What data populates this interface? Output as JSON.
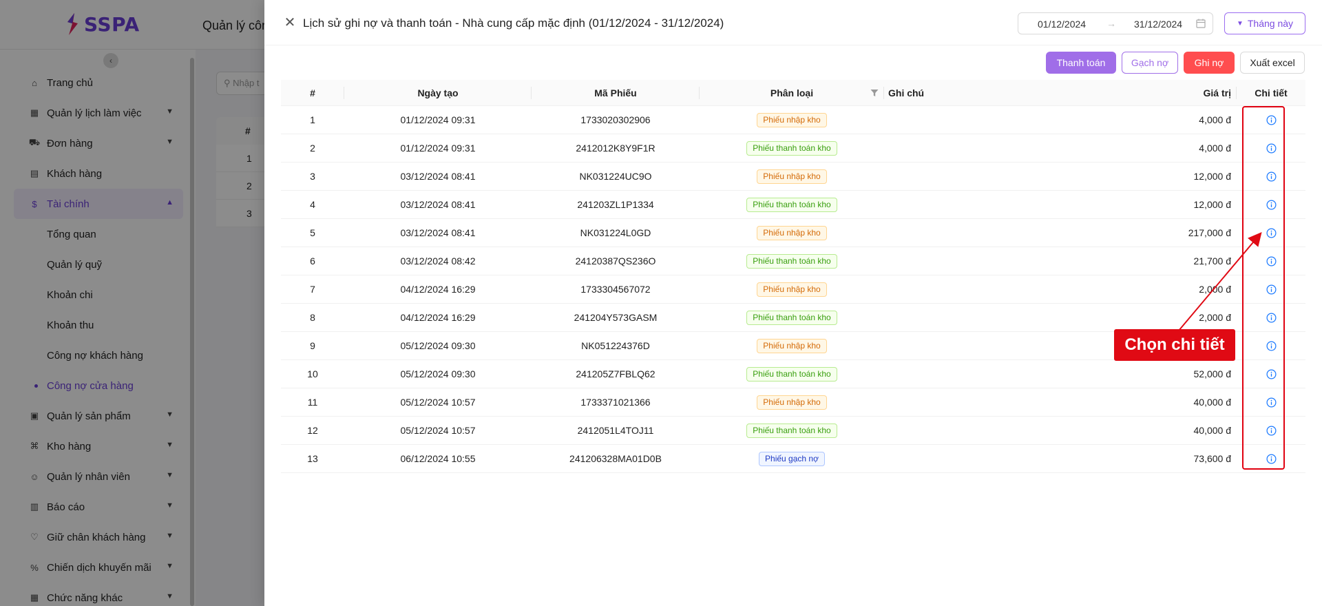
{
  "app": {
    "logo_text": "SSPA",
    "page_title": "Quản lý côn",
    "brand_color": "#6b3fd8"
  },
  "sidebar": {
    "items": [
      {
        "label": "Trang chủ",
        "icon": "home-icon"
      },
      {
        "label": "Quản lý lịch làm việc",
        "icon": "calendar-icon"
      },
      {
        "label": "Đơn hàng",
        "icon": "cart-icon"
      },
      {
        "label": "Khách hàng",
        "icon": "id-card-icon"
      },
      {
        "label": "Tài chính",
        "icon": "dollar-icon"
      },
      {
        "label": "Quản lý sản phẩm",
        "icon": "box-icon"
      },
      {
        "label": "Kho hàng",
        "icon": "warehouse-icon"
      },
      {
        "label": "Quản lý nhân viên",
        "icon": "users-icon"
      },
      {
        "label": "Báo cáo",
        "icon": "chart-icon"
      },
      {
        "label": "Giữ chân khách hàng",
        "icon": "heart-icon"
      },
      {
        "label": "Chiến dịch khuyến mãi",
        "icon": "percent-icon"
      },
      {
        "label": "Chức năng khác",
        "icon": "grid-icon"
      }
    ],
    "finance_sub": [
      "Tổng quan",
      "Quản lý quỹ",
      "Khoản chi",
      "Khoản thu",
      "Công nợ khách hàng",
      "Công nợ cửa hàng"
    ]
  },
  "background": {
    "search_placeholder": "Nhập t",
    "table_header": "#",
    "rows": [
      "1",
      "2",
      "3"
    ]
  },
  "drawer": {
    "title": "Lịch sử ghi nợ và thanh toán - Nhà cung cấp mặc định (01/12/2024 - 31/12/2024)",
    "date_start": "01/12/2024",
    "date_arrow": "→",
    "date_end": "31/12/2024",
    "month_button": "Tháng này",
    "buttons": {
      "pay": "Thanh toán",
      "clear": "Gạch nợ",
      "debt": "Ghi nợ",
      "excel": "Xuất excel"
    },
    "columns": {
      "index": "#",
      "date": "Ngày tạo",
      "code": "Mã Phiếu",
      "type": "Phân loại",
      "note": "Ghi chú",
      "value": "Giá trị",
      "detail": "Chi tiết"
    },
    "rows": [
      {
        "idx": "1",
        "date": "01/12/2024 09:31",
        "code": "1733020302906",
        "type": "Phiếu nhập kho",
        "kind": "import",
        "note": "",
        "value": "4,000 đ"
      },
      {
        "idx": "2",
        "date": "01/12/2024 09:31",
        "code": "2412012K8Y9F1R",
        "type": "Phiếu thanh toán kho",
        "kind": "pay",
        "note": "",
        "value": "4,000 đ"
      },
      {
        "idx": "3",
        "date": "03/12/2024 08:41",
        "code": "NK031224UC9O",
        "type": "Phiếu nhập kho",
        "kind": "import",
        "note": "",
        "value": "12,000 đ"
      },
      {
        "idx": "4",
        "date": "03/12/2024 08:41",
        "code": "241203ZL1P1334",
        "type": "Phiếu thanh toán kho",
        "kind": "pay",
        "note": "",
        "value": "12,000 đ"
      },
      {
        "idx": "5",
        "date": "03/12/2024 08:41",
        "code": "NK031224L0GD",
        "type": "Phiếu nhập kho",
        "kind": "import",
        "note": "",
        "value": "217,000 đ"
      },
      {
        "idx": "6",
        "date": "03/12/2024 08:42",
        "code": "24120387QS236O",
        "type": "Phiếu thanh toán kho",
        "kind": "pay",
        "note": "",
        "value": "21,700 đ"
      },
      {
        "idx": "7",
        "date": "04/12/2024 16:29",
        "code": "1733304567072",
        "type": "Phiếu nhập kho",
        "kind": "import",
        "note": "",
        "value": "2,000 đ"
      },
      {
        "idx": "8",
        "date": "04/12/2024 16:29",
        "code": "241204Y573GASM",
        "type": "Phiếu thanh toán kho",
        "kind": "pay",
        "note": "",
        "value": "2,000 đ"
      },
      {
        "idx": "9",
        "date": "05/12/2024 09:30",
        "code": "NK051224376D",
        "type": "Phiếu nhập kho",
        "kind": "import",
        "note": "",
        "value": ""
      },
      {
        "idx": "10",
        "date": "05/12/2024 09:30",
        "code": "241205Z7FBLQ62",
        "type": "Phiếu thanh toán kho",
        "kind": "pay",
        "note": "",
        "value": "52,000 đ"
      },
      {
        "idx": "11",
        "date": "05/12/2024 10:57",
        "code": "1733371021366",
        "type": "Phiếu nhập kho",
        "kind": "import",
        "note": "",
        "value": "40,000 đ"
      },
      {
        "idx": "12",
        "date": "05/12/2024 10:57",
        "code": "2412051L4TOJ11",
        "type": "Phiếu thanh toán kho",
        "kind": "pay",
        "note": "",
        "value": "40,000 đ"
      },
      {
        "idx": "13",
        "date": "06/12/2024 10:55",
        "code": "241206328MA01D0B",
        "type": "Phiếu gạch nợ",
        "kind": "clear",
        "note": "",
        "value": "73,600 đ"
      }
    ]
  },
  "annotation": {
    "callout_text": "Chọn chi tiết",
    "color": "#e00a14"
  }
}
